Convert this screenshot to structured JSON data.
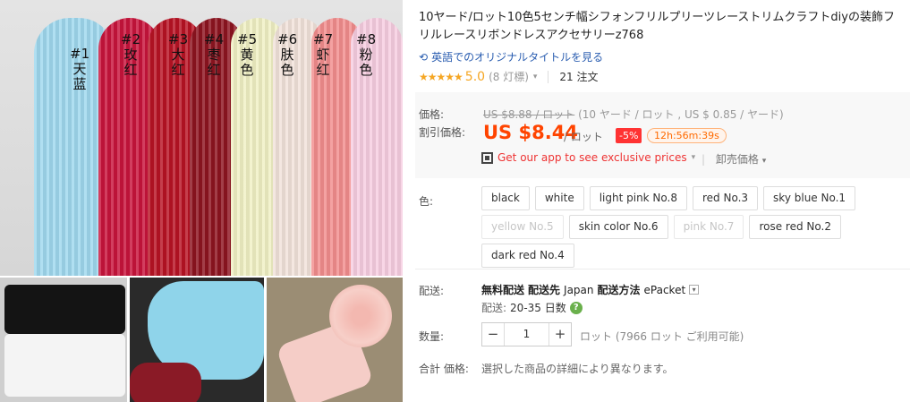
{
  "gallery": {
    "ribbons": [
      {
        "num": "#1",
        "name": "天蓝",
        "color": "#9fd8ee"
      },
      {
        "num": "#2",
        "name": "玫红",
        "color": "#c8143c"
      },
      {
        "num": "#3",
        "name": "大红",
        "color": "#b81324"
      },
      {
        "num": "#4",
        "name": "枣红",
        "color": "#8d1420"
      },
      {
        "num": "#5",
        "name": "黄色",
        "color": "#f0f0c4"
      },
      {
        "num": "#6",
        "name": "肤色",
        "color": "#f1e2da"
      },
      {
        "num": "#7",
        "name": "虾红",
        "color": "#f28d8d"
      },
      {
        "num": "#8",
        "name": "粉色",
        "color": "#f6cde0"
      }
    ]
  },
  "product": {
    "title": "10ヤード/ロット10色5センチ幅シフォンフリルプリーツレーストリムクラフトdiyの装飾フリルレースリボンドレスアクセサリーz768",
    "translate_link": "英語でのオリジナルタイトルを見る",
    "stars": "★★★★★",
    "rating": "5.0",
    "rating_count": "(8 灯標)",
    "orders": "21 注文"
  },
  "price": {
    "label": "価格:",
    "old_price": "US $8.88 / ロット",
    "old_detail": "(10 ヤード / ロット , US $ 0.85 / ヤード)",
    "discount_label": "割引価格:",
    "new_price": "US $8.44",
    "unit": "/ ロット",
    "discount": "-5%",
    "timer": "12h:56m:39s",
    "app_link": "Get our app to see exclusive prices",
    "wholesale": "卸売価格"
  },
  "colors": {
    "label": "色:",
    "options": [
      {
        "label": "black",
        "available": true
      },
      {
        "label": "white",
        "available": true
      },
      {
        "label": "light pink No.8",
        "available": true
      },
      {
        "label": "red No.3",
        "available": true
      },
      {
        "label": "sky blue No.1",
        "available": true
      },
      {
        "label": "yellow No.5",
        "available": false
      },
      {
        "label": "skin color No.6",
        "available": true
      },
      {
        "label": "pink No.7",
        "available": false
      },
      {
        "label": "rose red No.2",
        "available": true
      },
      {
        "label": "dark red No.4",
        "available": true
      }
    ]
  },
  "shipping": {
    "label": "配送:",
    "free": "無料配送",
    "to_label": "配送先",
    "country": "Japan",
    "method_label": "配送方法",
    "method": "ePacket",
    "time_label": "配送:",
    "time": "20-35 日数"
  },
  "quantity": {
    "label": "数量:",
    "minus": "−",
    "value": "1",
    "plus": "+",
    "stock": "ロット (7966 ロット ご利用可能)"
  },
  "total": {
    "label": "合計 価格:",
    "value": "選択した商品の詳細により異なります。"
  }
}
